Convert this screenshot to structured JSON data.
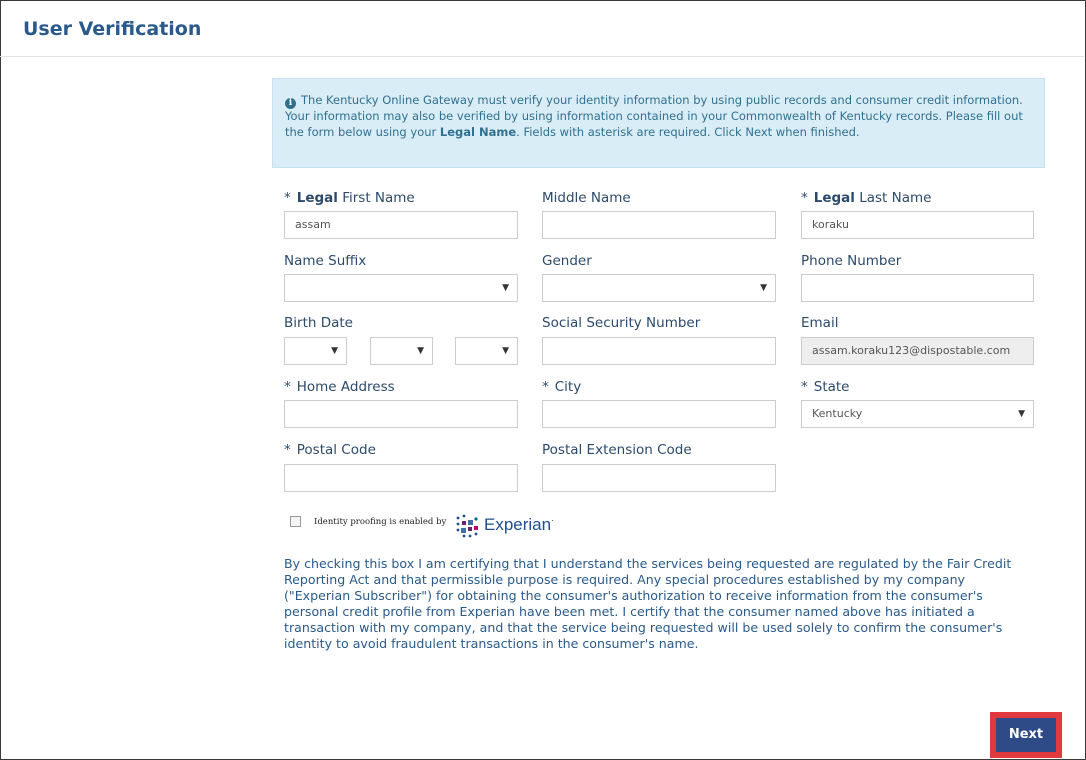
{
  "page": {
    "title": "User Verification"
  },
  "info": {
    "text_before": "The Kentucky Online Gateway must verify your identity information by using public records and consumer credit information. Your information may also be verified by using information contained in your Commonwealth of Kentucky records. Please fill out the form below using your ",
    "bold": "Legal Name",
    "text_after": ". Fields with asterisk are required. Click Next when finished."
  },
  "form": {
    "first_name": {
      "req": "*",
      "bold": "Legal",
      "label": " First Name",
      "value": "assam"
    },
    "middle_name": {
      "label": "Middle Name",
      "value": ""
    },
    "last_name": {
      "req": "*",
      "bold": "Legal",
      "label": " Last Name",
      "value": "koraku"
    },
    "name_suffix": {
      "label": "Name Suffix",
      "value": ""
    },
    "gender": {
      "label": "Gender",
      "value": ""
    },
    "phone": {
      "label": "Phone Number",
      "value": ""
    },
    "birth_date": {
      "label": "Birth Date",
      "month": "",
      "day": "",
      "year": ""
    },
    "ssn": {
      "label": "Social Security Number",
      "value": ""
    },
    "email": {
      "label": "Email",
      "value": "assam.koraku123@dispostable.com"
    },
    "home_address": {
      "req": "*",
      "label": "Home Address",
      "value": ""
    },
    "city": {
      "req": "*",
      "label": "City",
      "value": ""
    },
    "state": {
      "req": "*",
      "label": "State",
      "value": "Kentucky"
    },
    "postal_code": {
      "req": "*",
      "label": "Postal Code",
      "value": ""
    },
    "postal_ext": {
      "label": "Postal Extension Code",
      "value": ""
    }
  },
  "identity": {
    "proofing_text": "Identity proofing is enabled by",
    "brand": "Experian",
    "brand_mark": "·",
    "certification": "By checking this box I am certifying that I understand the services being requested are regulated by the Fair Credit Reporting Act and that permissible purpose is required. Any special procedures established by my company (\"Experian Subscriber\") for obtaining the consumer's authorization to receive information from the consumer's personal credit profile from Experian have been met. I certify that the consumer named above has initiated a transaction with my company, and that the service being requested will be used solely to confirm the consumer's identity to avoid fraudulent transactions in the consumer's name."
  },
  "actions": {
    "next_label": "Next"
  },
  "colors": {
    "accent": "#2a5a8a",
    "info_bg": "#d9edf7",
    "button": "#2e4a87",
    "highlight": "#e0393e"
  }
}
